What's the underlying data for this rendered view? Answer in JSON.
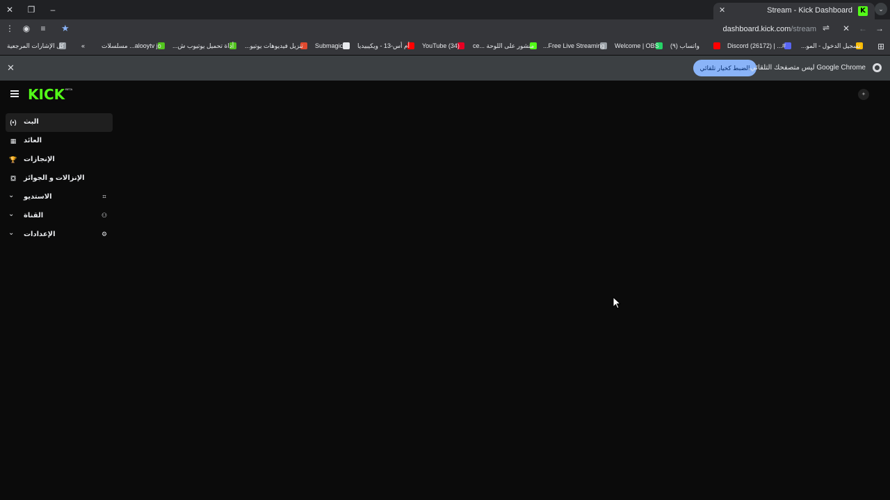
{
  "browser": {
    "tab_title": "Stream - Kick Dashboard",
    "tab_favicon": "K",
    "url_host": "dashboard.kick.com",
    "url_path": "/stream"
  },
  "bookmarks": [
    {
      "label": "تسجيل الدخول - المو...",
      "icon": "loading-icon",
      "color": "#fbbc04"
    },
    {
      "label": "#... | Discord (26172)",
      "icon": "discord-icon",
      "color": "#5865f2"
    },
    {
      "label": "واتساب (٩)",
      "icon": "youtube-icon",
      "color": "#ff0000"
    },
    {
      "label": "Welcome | OBS",
      "icon": "whatsapp-icon",
      "color": "#25d366"
    },
    {
      "label": "Free Live Streaming...",
      "icon": "obs-icon",
      "color": "#9aa0a6"
    },
    {
      "label": "منشور على اللوحة ...ce",
      "icon": "stream-icon",
      "color": "#53fc18"
    },
    {
      "label": "YouTube (34)",
      "icon": "pinterest-icon",
      "color": "#e60023"
    },
    {
      "label": "أم أس-13 - ويكيبيديا",
      "icon": "youtube-icon",
      "color": "#ff0000"
    },
    {
      "label": "Submagic",
      "icon": "wikipedia-icon",
      "color": "#e8eaed"
    },
    {
      "label": "تنزيل فيديوهات يوتيو...",
      "icon": "submagic-icon",
      "color": "#e04a2f"
    },
    {
      "label": "أداة تحميل يوتيوب ش...",
      "icon": "download-icon",
      "color": "#53c61e"
    },
    {
      "label": "alooytv jo... مسلسلات",
      "icon": "download-icon",
      "color": "#53c61e"
    },
    {
      "label": "كل الإشارات المرجعية",
      "icon": "tv-icon",
      "color": "#9aa0a6"
    }
  ],
  "infobar": {
    "message": "Google Chrome ليس متصفحك التلقائي.",
    "button": "الضبط كخيار تلقائي"
  },
  "app": {
    "logo": "KICK",
    "logo_badge": "BETA"
  },
  "sidebar": {
    "items": [
      {
        "label": "البث",
        "icon": "live-icon",
        "glyph": "(•)",
        "active": true
      },
      {
        "label": "العائد",
        "icon": "revenue-icon",
        "glyph": "▦"
      },
      {
        "label": "الإنجازات",
        "icon": "trophy-icon",
        "glyph": "🏆"
      },
      {
        "label": "الإنزالات و الجوائز",
        "icon": "drops-icon",
        "glyph": "⛋"
      },
      {
        "label": "الاستديو",
        "icon": "studio-icon",
        "glyph": "⌗",
        "expandable": true
      },
      {
        "label": "القناة",
        "icon": "channel-icon",
        "glyph": "⚇",
        "expandable": true
      },
      {
        "label": "الإعدادات",
        "icon": "settings-icon",
        "glyph": "⚙",
        "expandable": true
      }
    ]
  }
}
